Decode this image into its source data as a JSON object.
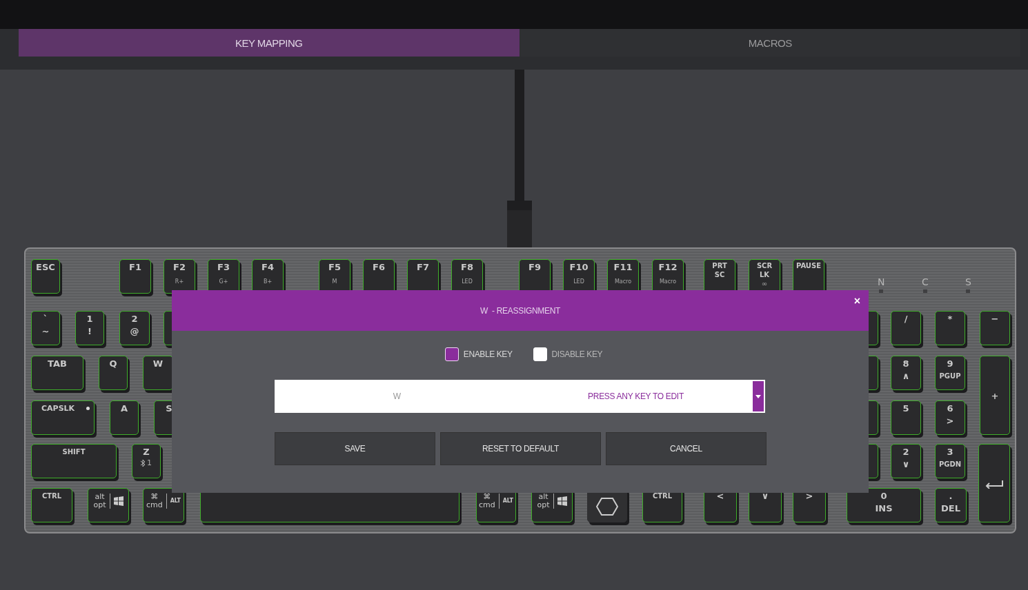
{
  "tabs": [
    {
      "label": "KEY MAPPING",
      "selected": true
    },
    {
      "label": "MACROS",
      "selected": false
    }
  ],
  "keyboard": {
    "keys": [
      {
        "kind": "plain",
        "lines": [
          "ESC"
        ]
      },
      {
        "kind": "plain",
        "lines": [
          "F1"
        ]
      },
      {
        "kind": "plain",
        "lines": [
          "F2",
          "R+"
        ]
      },
      {
        "kind": "plain",
        "lines": [
          "F3",
          "G+"
        ]
      },
      {
        "kind": "plain",
        "lines": [
          "F4",
          "B+"
        ]
      },
      {
        "kind": "plain",
        "lines": [
          "F5",
          "M"
        ]
      },
      {
        "kind": "plain",
        "lines": [
          "F6"
        ]
      },
      {
        "kind": "plain",
        "lines": [
          "F7"
        ]
      },
      {
        "kind": "plain",
        "lines": [
          "F8",
          "LED"
        ]
      },
      {
        "kind": "plain",
        "lines": [
          "F9"
        ]
      },
      {
        "kind": "plain",
        "lines": [
          "F10",
          "LED"
        ]
      },
      {
        "kind": "plain",
        "lines": [
          "F11",
          "Macro"
        ]
      },
      {
        "kind": "plain",
        "lines": [
          "F12",
          "Macro"
        ]
      },
      {
        "kind": "plain",
        "lines": [
          "PRT",
          "SC"
        ]
      },
      {
        "kind": "plain",
        "lines": [
          "SCR",
          "LK",
          "∞"
        ]
      },
      {
        "kind": "plain",
        "lines": [
          "PAUSE"
        ]
      },
      {
        "kind": "plain",
        "lines": [
          "`",
          "~"
        ]
      },
      {
        "kind": "plain",
        "lines": [
          "1",
          "!"
        ]
      },
      {
        "kind": "plain",
        "lines": [
          "2",
          "@"
        ]
      },
      {
        "kind": "plain",
        "lines": [
          "/"
        ]
      },
      {
        "kind": "plain",
        "lines": [
          "*"
        ]
      },
      {
        "kind": "plain",
        "lines": [
          "−"
        ]
      },
      {
        "kind": "plain",
        "lines": [
          "TAB"
        ]
      },
      {
        "kind": "plain",
        "lines": [
          "Q"
        ]
      },
      {
        "kind": "plain",
        "lines": [
          "W"
        ]
      },
      {
        "kind": "plain",
        "lines": [
          "8",
          "∧"
        ]
      },
      {
        "kind": "plain",
        "lines": [
          "9",
          "PGUP"
        ]
      },
      {
        "kind": "plain",
        "lines": [
          "+"
        ]
      },
      {
        "kind": "led",
        "lines": [
          "CAPSLK"
        ]
      },
      {
        "kind": "plain",
        "lines": [
          "A"
        ]
      },
      {
        "kind": "plain",
        "lines": [
          "S"
        ]
      },
      {
        "kind": "plain",
        "lines": [
          "5"
        ]
      },
      {
        "kind": "plain",
        "lines": [
          "6",
          ">"
        ]
      },
      {
        "kind": "plain",
        "lines": [
          "SHIFT"
        ]
      },
      {
        "kind": "bt",
        "lines": [
          "Z",
          "1"
        ]
      },
      {
        "kind": "plain",
        "lines": [
          "2",
          "∨"
        ]
      },
      {
        "kind": "plain",
        "lines": [
          "3",
          "PGDN"
        ]
      },
      {
        "kind": "enter"
      },
      {
        "kind": "plain",
        "lines": [
          "CTRL"
        ]
      },
      {
        "kind": "win",
        "lines": [
          "alt",
          "opt"
        ]
      },
      {
        "kind": "cmd",
        "lines": [
          "⌘",
          "cmd"
        ],
        "side": "ALT"
      },
      {
        "kind": "plain"
      },
      {
        "kind": "cmd",
        "lines": [
          "⌘",
          "cmd"
        ],
        "side": "ALT"
      },
      {
        "kind": "win",
        "lines": [
          "alt",
          "opt"
        ]
      },
      {
        "kind": "logo"
      },
      {
        "kind": "plain",
        "lines": [
          "CTRL"
        ]
      },
      {
        "kind": "plain",
        "lines": [
          "<"
        ]
      },
      {
        "kind": "plain",
        "lines": [
          "∨"
        ]
      },
      {
        "kind": "plain",
        "lines": [
          ">"
        ]
      },
      {
        "kind": "plain",
        "lines": [
          "0",
          "INS"
        ]
      },
      {
        "kind": "plain",
        "lines": [
          ".",
          "DEL"
        ]
      }
    ],
    "indicators": [
      "N",
      "C",
      "S"
    ]
  },
  "modal": {
    "title": "W  - REASSIGNMENT",
    "close": "×",
    "options": [
      {
        "label": "ENABLE KEY",
        "checked": true
      },
      {
        "label": "DISABLE KEY",
        "checked": false
      }
    ],
    "original_key": "W",
    "placeholder": "PRESS ANY KEY TO EDIT",
    "buttons": [
      "SAVE",
      "RESET TO DEFAULT",
      "CANCEL"
    ]
  }
}
